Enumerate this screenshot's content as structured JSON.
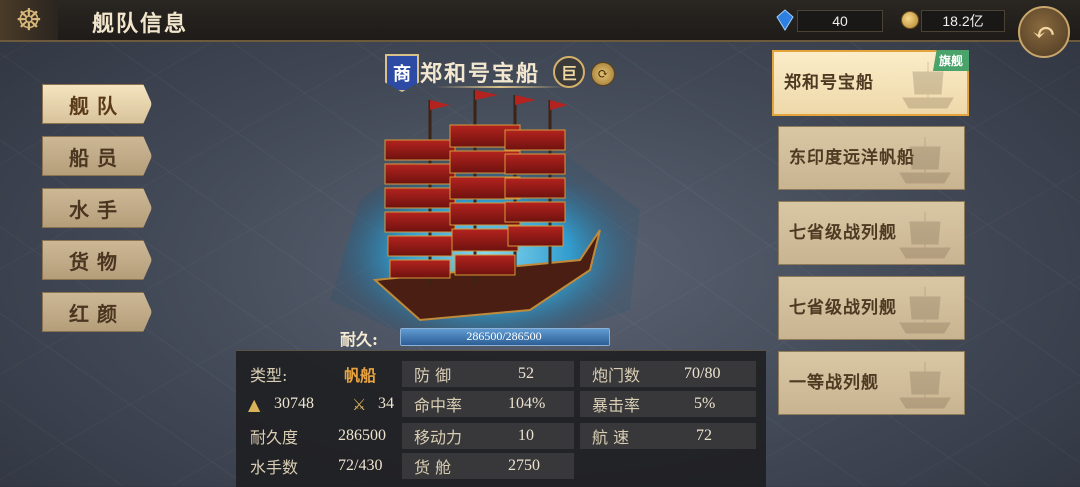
{
  "header": {
    "title": "舰队信息",
    "gems": "40",
    "coins": "18.2亿"
  },
  "tabs": [
    {
      "label": "舰队",
      "active": true
    },
    {
      "label": "船员",
      "active": false
    },
    {
      "label": "水手",
      "active": false
    },
    {
      "label": "货物",
      "active": false
    },
    {
      "label": "红颜",
      "active": false
    }
  ],
  "ship": {
    "type_badge": "商",
    "name": "郑和号宝船",
    "size_badge": "巨",
    "durability_label": "耐久:",
    "durability_value": "286500/286500",
    "durability_fraction": 1.0
  },
  "stats": {
    "type_label": "类型:",
    "type_value": "帆船",
    "cargo_icon_value": "30748",
    "swords_icon_value": "34",
    "durability_label": "耐久度",
    "durability_value": "286500",
    "sailors_label": "水手数",
    "sailors_value": "72/430",
    "defense_label": "防 御",
    "defense_value": "52",
    "accuracy_label": "命中率",
    "accuracy_value": "104%",
    "mobility_label": "移动力",
    "mobility_value": "10",
    "hold_label": "货 舱",
    "hold_value": "2750",
    "cannons_label": "炮门数",
    "cannons_value": "70/80",
    "crit_label": "暴击率",
    "crit_value": "5%",
    "speed_label": "航 速",
    "speed_value": "72"
  },
  "fleet": [
    {
      "name": "郑和号宝船",
      "flagship": "旗舰",
      "active": true
    },
    {
      "name": "东印度远洋帆船",
      "active": false
    },
    {
      "name": "七省级战列舰",
      "active": false
    },
    {
      "name": "七省级战列舰",
      "active": false
    },
    {
      "name": "一等战列舰",
      "active": false
    }
  ],
  "colors": {
    "accent_gold": "#e8a33f",
    "flag_green": "#4aa36a",
    "ocean_blue": "#2ea3d8"
  }
}
